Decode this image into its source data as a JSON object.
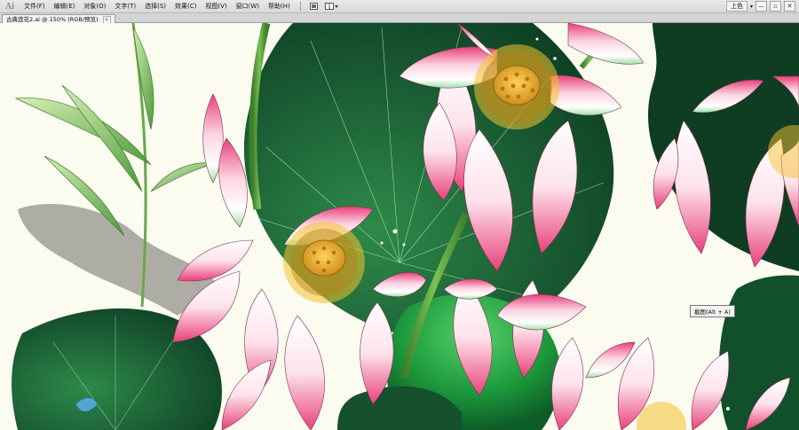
{
  "app": {
    "logo": "Ai"
  },
  "menu": {
    "items": [
      "文件(F)",
      "编辑(E)",
      "对象(O)",
      "文字(T)",
      "选择(S)",
      "效果(C)",
      "视图(V)",
      "窗口(W)",
      "帮助(H)"
    ]
  },
  "toolbar": {
    "arrange_icon": "arrange-documents-icon",
    "workspace_label": "上色"
  },
  "window_buttons": {
    "minimize": "—",
    "restore": "▫",
    "close": "✕"
  },
  "document": {
    "tab_title": "古典莲花2.ai @ 150% (RGB/预览)",
    "close_glyph": "×"
  },
  "tooltip": {
    "text": "截图(Alt + A)"
  },
  "colors": {
    "pad_dark": "#0f4a28",
    "pad_mid": "#1f7a3c",
    "lotus_pink": "#e8407a",
    "stem": "#5aa040",
    "canvas_bg": "#fbfbef"
  }
}
